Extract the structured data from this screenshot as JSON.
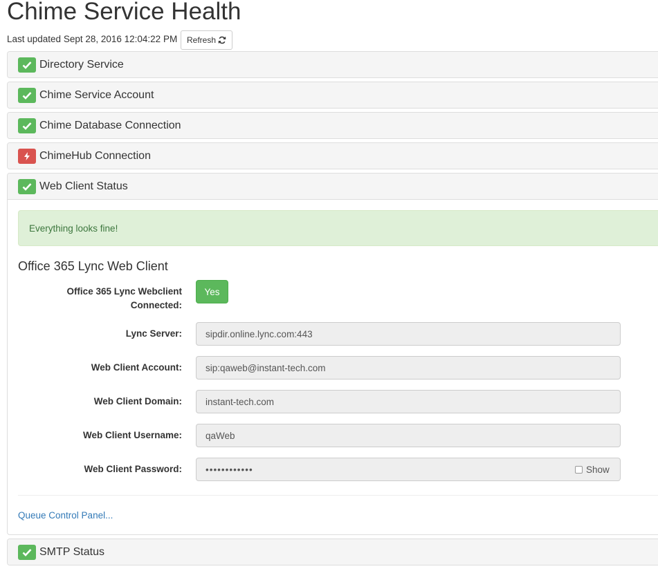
{
  "page": {
    "title": "Chime Service Health",
    "last_updated": "Last updated Sept 28, 2016 12:04:22 PM",
    "refresh_label": "Refresh"
  },
  "colors": {
    "ok": "#5cb85c",
    "error": "#d9534f",
    "link": "#337ab7",
    "alert_bg": "#dff0d8",
    "alert_text": "#3c763d"
  },
  "services": [
    {
      "name": "Directory Service",
      "status": "ok",
      "icon": "check-icon"
    },
    {
      "name": "Chime Service Account",
      "status": "ok",
      "icon": "check-icon"
    },
    {
      "name": "Chime Database Connection",
      "status": "ok",
      "icon": "check-icon"
    },
    {
      "name": "ChimeHub Connection",
      "status": "error",
      "icon": "bolt-icon"
    },
    {
      "name": "Web Client Status",
      "status": "ok",
      "icon": "check-icon",
      "expanded": true
    },
    {
      "name": "SMTP Status",
      "status": "ok",
      "icon": "check-icon"
    }
  ],
  "web_client": {
    "alert": "Everything looks fine!",
    "section_title": "Office 365 Lync Web Client",
    "connected_label": "Office 365 Lync Webclient Connected:",
    "connected_value": "Yes",
    "fields": [
      {
        "label": "Lync Server:",
        "value": "sipdir.online.lync.com:443"
      },
      {
        "label": "Web Client Account:",
        "value": "sip:qaweb@instant-tech.com"
      },
      {
        "label": "Web Client Domain:",
        "value": "instant-tech.com"
      },
      {
        "label": "Web Client Username:",
        "value": "qaWeb"
      }
    ],
    "password_label": "Web Client Password:",
    "password_value": "••••••••••••",
    "show_label": "Show",
    "show_checked": false,
    "queue_link": "Queue Control Panel..."
  }
}
